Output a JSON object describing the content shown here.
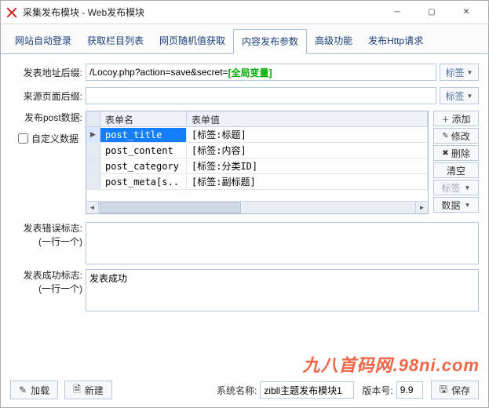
{
  "window": {
    "title": "采集发布模块 - Web发布模块"
  },
  "tabs": [
    "网站自动登录",
    "获取栏目列表",
    "网页随机值获取",
    "内容发布参数",
    "高级功能",
    "发布Http请求"
  ],
  "active_tab_index": 3,
  "labels": {
    "post_url_suffix": "发表地址后缀:",
    "source_page_suffix": "来源页面后缀:",
    "post_data": "发布post数据:",
    "custom_data": "自定义数据",
    "error_mark": "发表错误标志:",
    "error_mark_hint": "(一行一个)",
    "success_mark": "发表成功标志:",
    "success_mark_hint": "(一行一个)"
  },
  "fields": {
    "post_url_suffix_plain": "/Locoy.php?action=save&secret=",
    "post_url_suffix_accent": "[全局变量]",
    "source_page_suffix": "",
    "custom_data_checked": false,
    "error_text": "",
    "success_text": "发表成功"
  },
  "tag_button": "标签",
  "grid": {
    "col_name": "表单名",
    "col_value": "表单值",
    "rows": [
      {
        "name": "post_title",
        "value": "[标签:标题]"
      },
      {
        "name": "post_content",
        "value": "[标签:内容]"
      },
      {
        "name": "post_category",
        "value": "[标签:分类ID]"
      },
      {
        "name": "post_meta[s..",
        "value": "[标签:副标题]"
      }
    ],
    "selected_row": 0
  },
  "side_buttons": {
    "add": "添加",
    "edit": "修改",
    "delete": "删除",
    "clear": "清空",
    "tag": "标签",
    "data": "数据"
  },
  "footer": {
    "load": "加载",
    "new": "新建",
    "sys_name_label": "系统名称:",
    "sys_name": "zibll主题发布模块1",
    "ver_label": "版本号:",
    "ver": "9.9",
    "save": "保存"
  },
  "watermark": "九八首码网.98ni.com"
}
